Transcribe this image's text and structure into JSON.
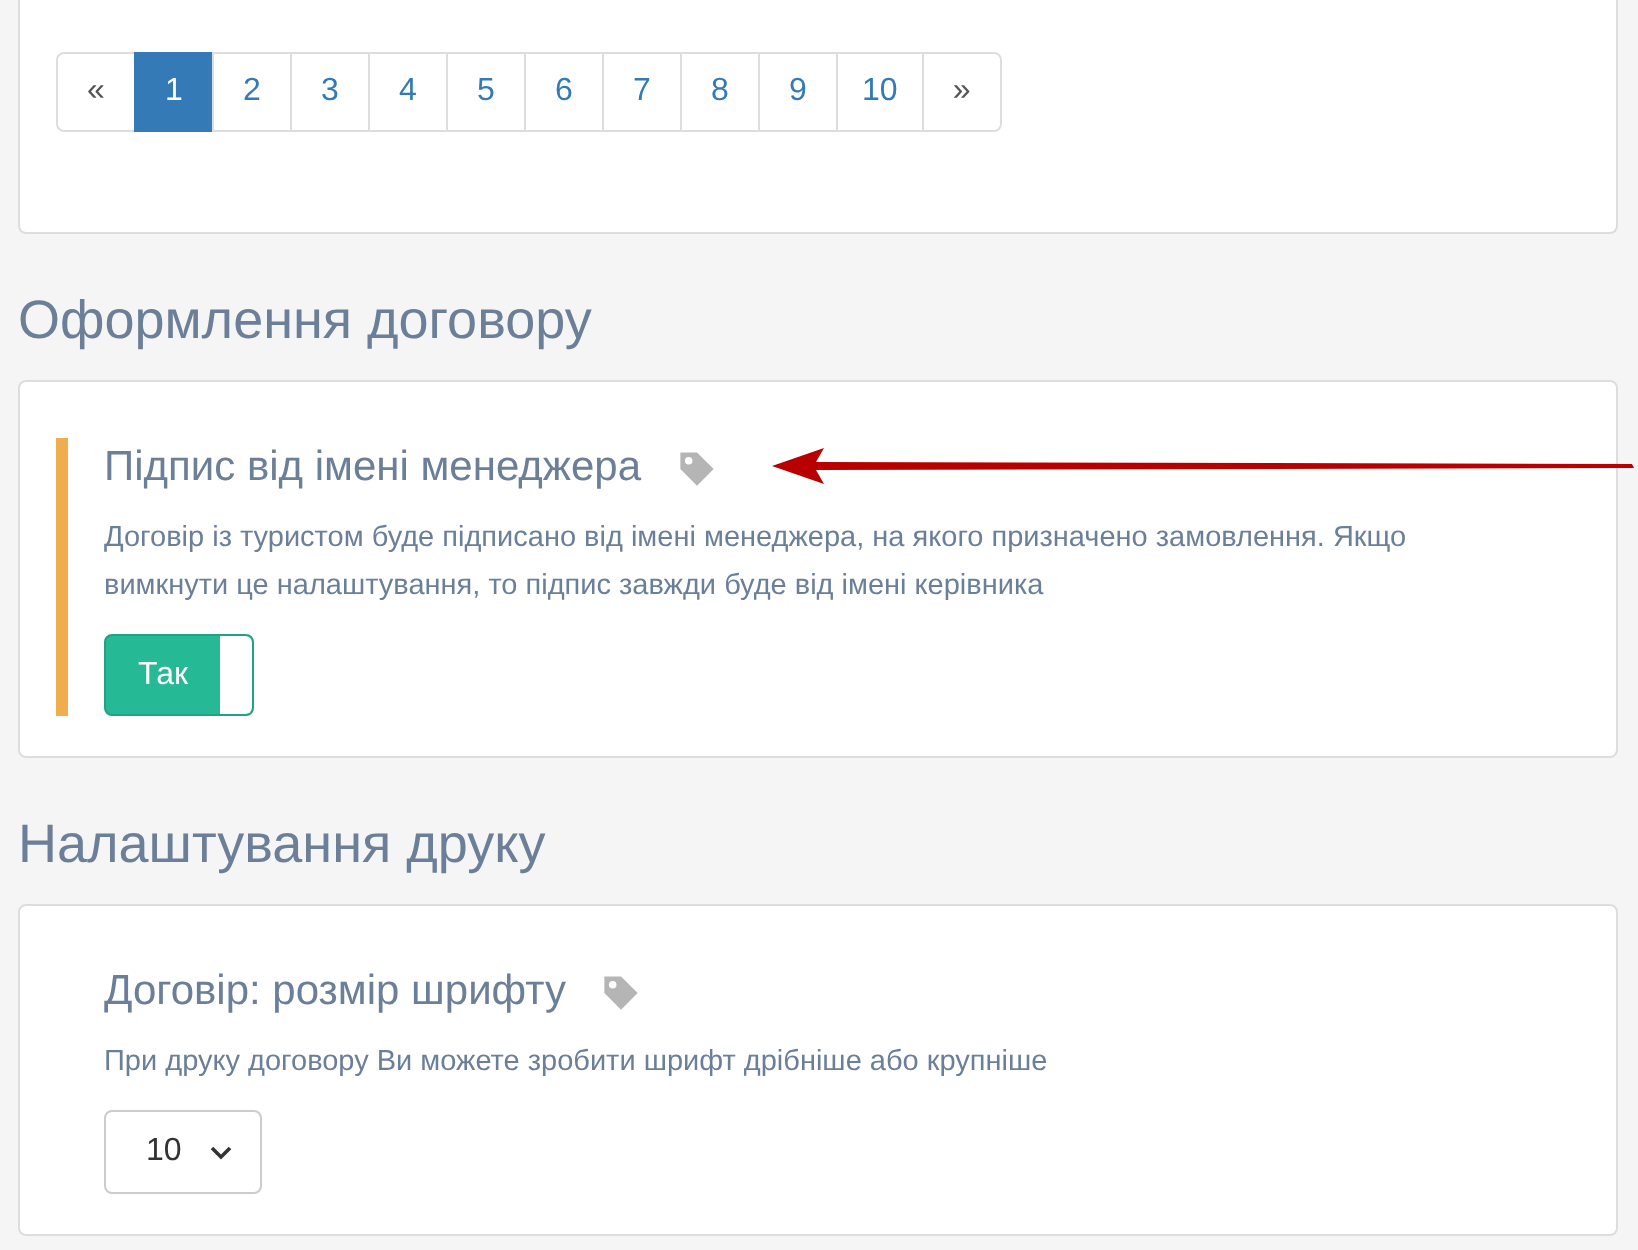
{
  "pagination": {
    "pages": [
      {
        "label": "«",
        "selected": false
      },
      {
        "label": "1",
        "selected": true
      },
      {
        "label": "2",
        "selected": false
      },
      {
        "label": "3",
        "selected": false
      },
      {
        "label": "4",
        "selected": false
      },
      {
        "label": "5",
        "selected": false
      },
      {
        "label": "6",
        "selected": false
      },
      {
        "label": "7",
        "selected": false
      },
      {
        "label": "8",
        "selected": false
      },
      {
        "label": "9",
        "selected": false
      },
      {
        "label": "10",
        "selected": false
      },
      {
        "label": "»",
        "selected": false
      }
    ]
  },
  "sections": [
    {
      "heading": "Оформлення договору",
      "setting": {
        "kind": "toggle",
        "title": "Підпис від імені менеджера",
        "highlighted": true,
        "annotated": true,
        "description": "Договір із туристом буде підписано від імені менеджера, на якого призначено замовлення. Якщо вимкнути це налаштування, то підпис завжди буде від імені керівника",
        "toggle": {
          "label": "Так",
          "on": true
        }
      }
    },
    {
      "heading": "Налаштування друку",
      "setting": {
        "kind": "select",
        "title": "Договір: розмір шрифту",
        "description": "При друку договору Ви можете зробити шрифт дрібніше або крупніше",
        "value": "10"
      }
    }
  ]
}
